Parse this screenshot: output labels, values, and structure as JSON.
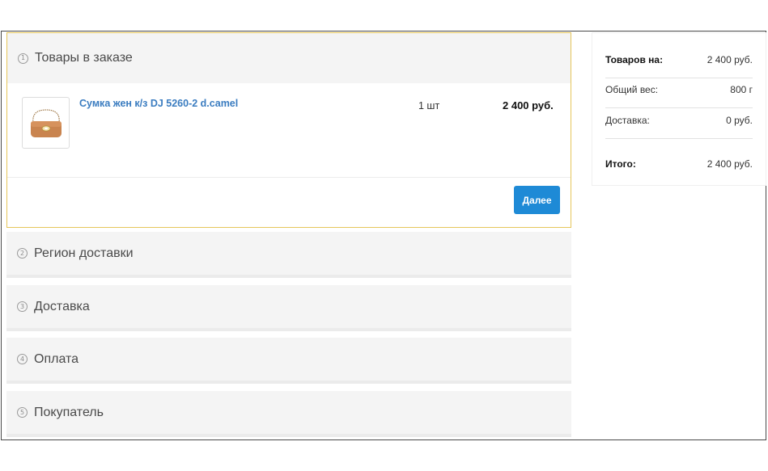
{
  "steps": [
    {
      "num": "1",
      "title": "Товары в заказе"
    },
    {
      "num": "2",
      "title": "Регион доставки"
    },
    {
      "num": "3",
      "title": "Доставка"
    },
    {
      "num": "4",
      "title": "Оплата"
    },
    {
      "num": "5",
      "title": "Покупатель"
    }
  ],
  "item": {
    "name": "Сумка жен к/з DJ 5260-2 d.camel",
    "qty": "1 шт",
    "price": "2 400 руб."
  },
  "next_button": "Далее",
  "summary": {
    "goods_label": "Товаров на:",
    "goods_value": "2 400 руб.",
    "weight_label": "Общий вес:",
    "weight_value": "800 г",
    "delivery_label": "Доставка:",
    "delivery_value": "0 руб.",
    "total_label": "Итого:",
    "total_value": "2 400 руб."
  },
  "colors": {
    "accent": "#1e8ad6",
    "link": "#3a7cc0",
    "active_border": "#e6c65a"
  }
}
